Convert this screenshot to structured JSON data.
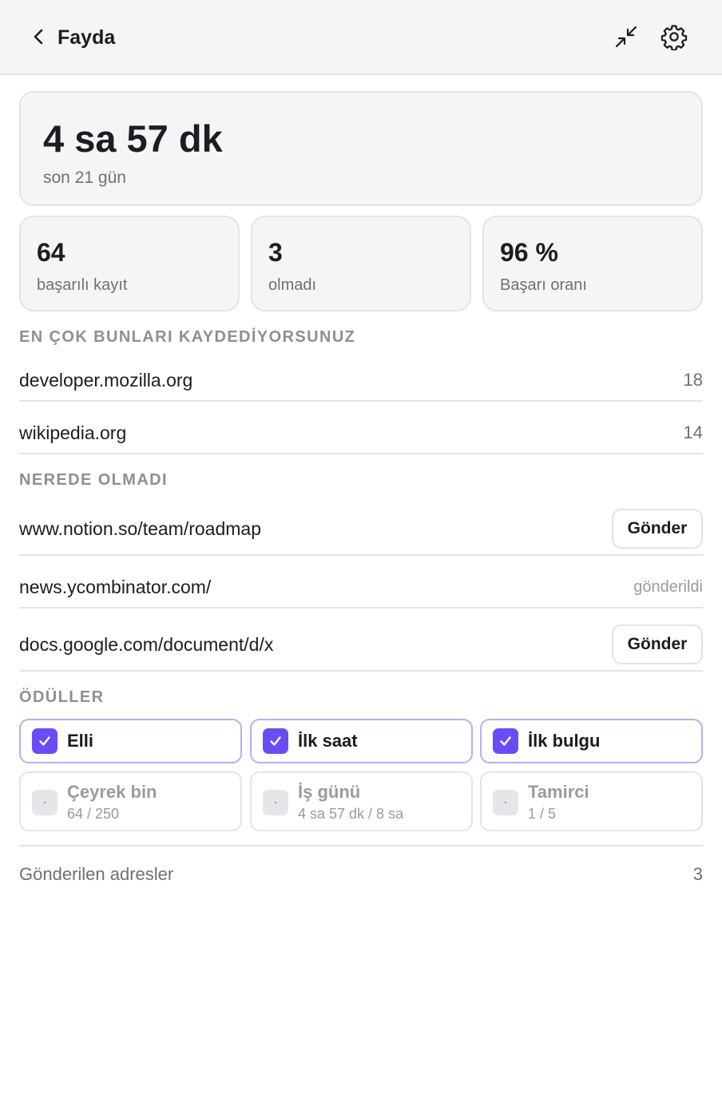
{
  "header": {
    "title": "Fayda",
    "back_icon": "chevron-left-icon",
    "collapse_icon": "collapse-arrows-icon",
    "settings_icon": "gear-icon"
  },
  "summary": {
    "total_time": "4 sa 57 dk",
    "period": "son 21 gün"
  },
  "stats": [
    {
      "value": "64",
      "label": "başarılı kayıt"
    },
    {
      "value": "3",
      "label": "olmadı"
    },
    {
      "value": "96 %",
      "label": "Başarı oranı"
    }
  ],
  "top_sites": {
    "title": "EN ÇOK BUNLARI KAYDEDİYORSUNUZ",
    "items": [
      {
        "domain": "developer.mozilla.org",
        "count": "18"
      },
      {
        "domain": "wikipedia.org",
        "count": "14"
      }
    ]
  },
  "failures": {
    "title": "NEREDE OLMADI",
    "send_label": "Gönder",
    "items": [
      {
        "url": "www.notion.so/team/roadmap",
        "status": "Gönder"
      },
      {
        "url": "news.ycombinator.com/",
        "status": "gönderildi"
      },
      {
        "url": "docs.google.com/document/d/x",
        "status": "Gönder"
      }
    ]
  },
  "awards": {
    "title": "ÖDÜLLER",
    "earned": [
      {
        "name": "Elli"
      },
      {
        "name": "İlk saat"
      },
      {
        "name": "İlk bulgu"
      }
    ],
    "locked": [
      {
        "name": "Çeyrek bin",
        "progress": "64 / 250"
      },
      {
        "name": "İş günü",
        "progress": "4 sa 57 dk / 8 sa"
      },
      {
        "name": "Tamirci",
        "progress": "1 / 5"
      }
    ]
  },
  "footer": {
    "label": "Gönderilen adresler",
    "count": "3"
  },
  "colors": {
    "accent": "#6a4cf5",
    "card_bg": "#f5f5f7",
    "border": "#e3e3e8",
    "muted_text": "#6f6f78"
  }
}
